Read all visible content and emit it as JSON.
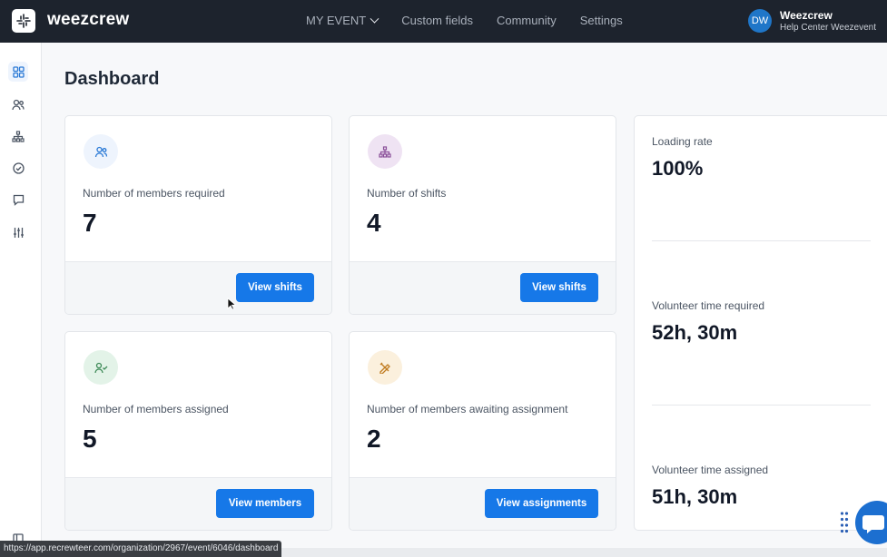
{
  "header": {
    "logo_text": "weezcrew",
    "nav": [
      {
        "label": "MY EVENT"
      },
      {
        "label": "Custom fields"
      },
      {
        "label": "Community"
      },
      {
        "label": "Settings"
      }
    ],
    "user": {
      "initials": "DW",
      "name": "Weezcrew",
      "subtitle": "Help Center Weezevent"
    }
  },
  "sidebar": {
    "items": [
      "dashboard-icon",
      "members-icon",
      "org-chart-icon",
      "check-circle-icon",
      "chat-icon",
      "sliders-icon"
    ],
    "bottom_icon": "panel-icon"
  },
  "page": {
    "title": "Dashboard"
  },
  "cards": [
    {
      "label": "Number of members required",
      "value": "7",
      "button": "View shifts",
      "icon": "members-icon",
      "icon_bg": "#eef4fd",
      "icon_color": "#2b7ad6"
    },
    {
      "label": "Number of shifts",
      "value": "4",
      "button": "View shifts",
      "icon": "org-chart-icon",
      "icon_bg": "#efe3f3",
      "icon_color": "#8a4f99"
    },
    {
      "label": "Number of members assigned",
      "value": "5",
      "button": "View members",
      "icon": "user-check-icon",
      "icon_bg": "#e3f3e8",
      "icon_color": "#3d8a57"
    },
    {
      "label": "Number of members awaiting assignment",
      "value": "2",
      "button": "View assignments",
      "icon": "pencil-ruler-icon",
      "icon_bg": "#fbf0dd",
      "icon_color": "#c07b1f"
    }
  ],
  "stats": [
    {
      "label": "Loading rate",
      "value": "100%"
    },
    {
      "label": "Volunteer time required",
      "value": "52h, 30m"
    },
    {
      "label": "Volunteer time assigned",
      "value": "51h, 30m"
    }
  ],
  "status_url": "https://app.recrewteer.com/organization/2967/event/6046/dashboard",
  "colors": {
    "accent": "#1678e8",
    "topbar": "#1d232d"
  }
}
